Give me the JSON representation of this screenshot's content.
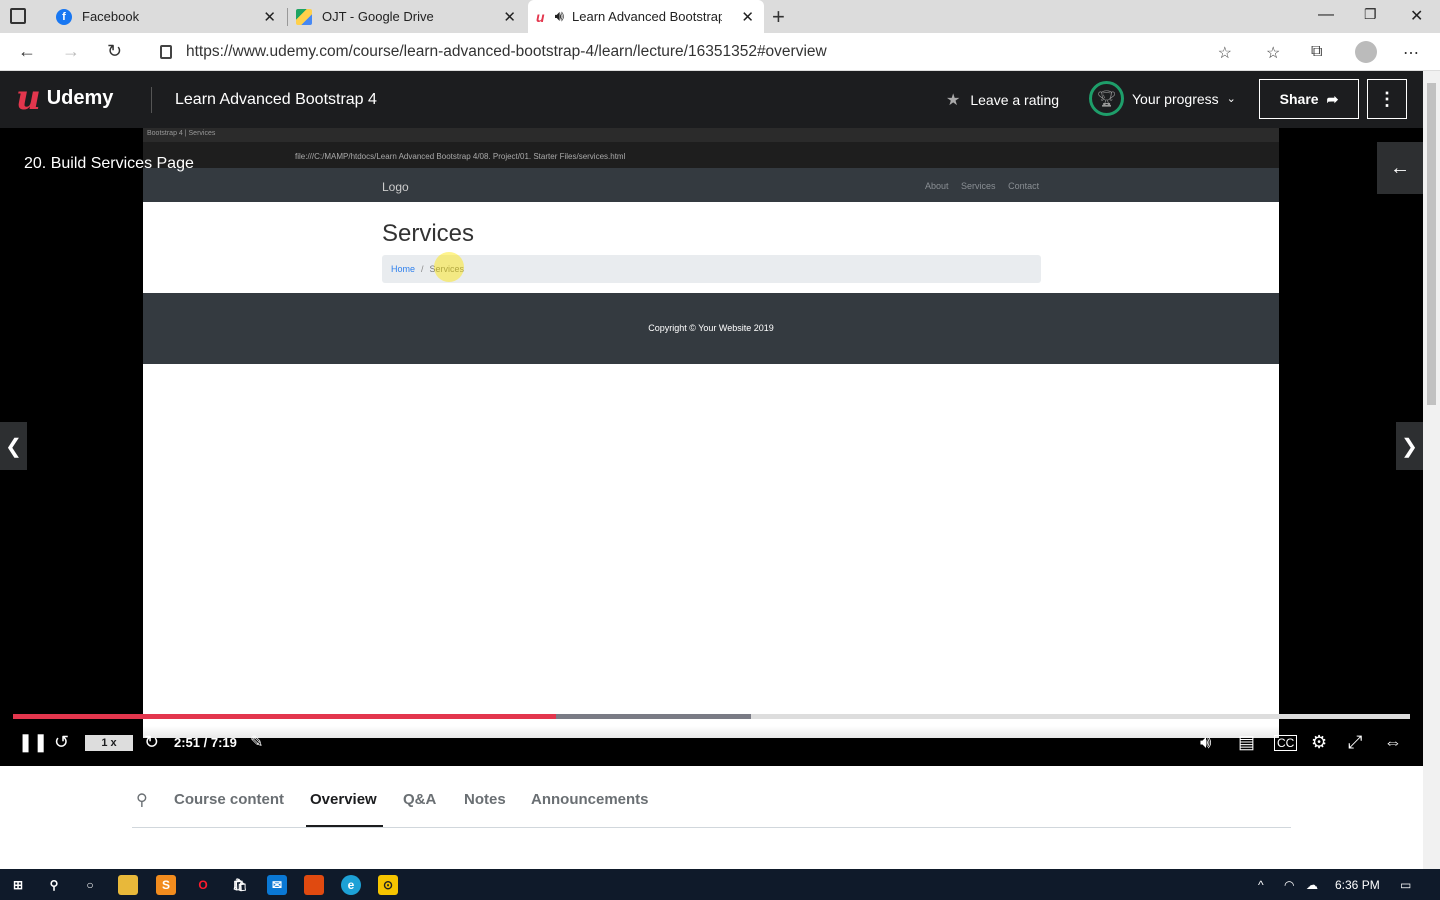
{
  "browser": {
    "tabs": [
      {
        "title": "Facebook"
      },
      {
        "title": "OJT - Google Drive"
      },
      {
        "title": "Learn Advanced Bootstrap 4"
      }
    ],
    "url": "https://www.udemy.com/course/learn-advanced-bootstrap-4/learn/lecture/16351352#overview"
  },
  "header": {
    "logo_text": "Udemy",
    "course_title": "Learn Advanced Bootstrap 4",
    "rating_label": "Leave a rating",
    "progress_label": "Your progress",
    "share_label": "Share"
  },
  "player": {
    "lecture_title": "20. Build Services Page",
    "played_fraction": 0.389,
    "buffered_fraction": 0.528,
    "speed": "1 x",
    "time": "2:51 / 7:19",
    "video": {
      "tab_text": "Bootstrap 4 | Services",
      "url_text": "file:///C:/MAMP/htdocs/Learn Advanced Bootstrap 4/08. Project/01. Starter Files/services.html",
      "logo": "Logo",
      "nav_links": [
        "About",
        "Services",
        "Contact"
      ],
      "heading": "Services",
      "breadcrumb_home": "Home",
      "breadcrumb_sep": "/",
      "breadcrumb_current": "Services",
      "footer_text": "Copyright © Your Website 2019"
    }
  },
  "tabsbar": {
    "items": [
      "Course content",
      "Overview",
      "Q&A",
      "Notes",
      "Announcements"
    ],
    "active": "Overview"
  },
  "taskbar": {
    "time": "6:36 PM"
  },
  "colors": {
    "accent": "#e3364d",
    "header_bg": "#1c1d1f",
    "progress_ring": "#1e9e6a"
  }
}
